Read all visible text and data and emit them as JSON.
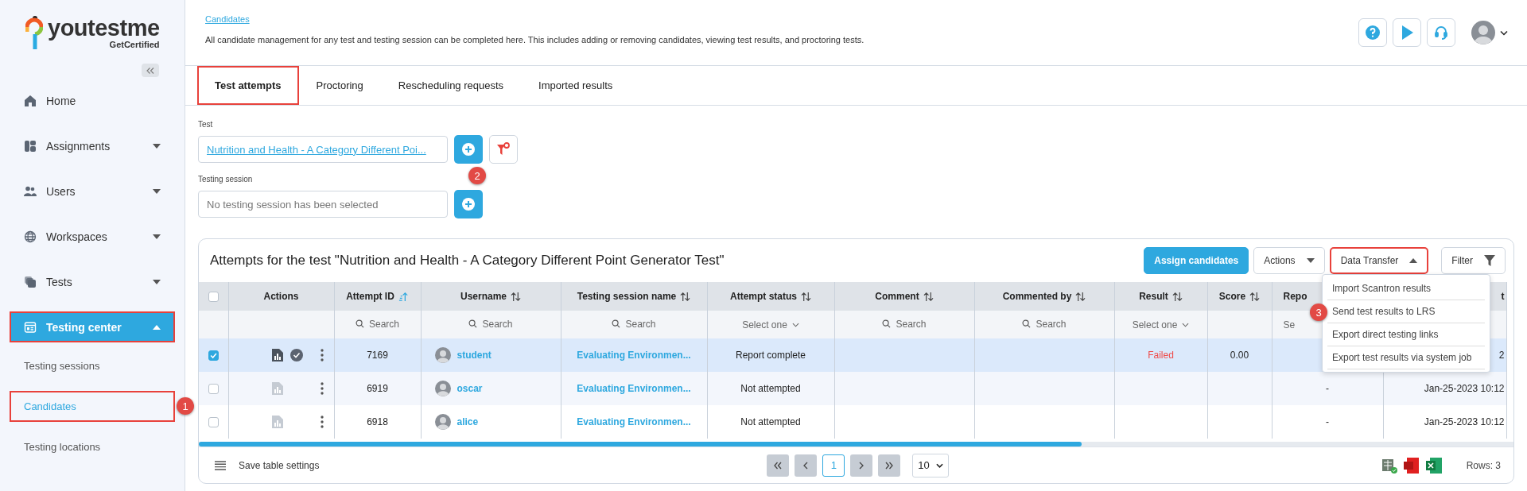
{
  "logo": {
    "name": "youtestme",
    "tagline": "GetCertified"
  },
  "sidebar": {
    "items": [
      {
        "kind": "home",
        "label": "Home",
        "selected": false,
        "highlighted": false
      },
      {
        "kind": "assignments",
        "label": "Assignments",
        "expanded": false,
        "selected": false,
        "highlighted": false
      },
      {
        "kind": "users",
        "label": "Users",
        "expanded": false,
        "selected": false,
        "highlighted": false
      },
      {
        "kind": "workspaces",
        "label": "Workspaces",
        "expanded": false,
        "selected": false,
        "highlighted": false
      },
      {
        "kind": "tests",
        "label": "Tests",
        "expanded": false,
        "selected": false,
        "highlighted": false
      },
      {
        "kind": "testing-center",
        "label": "Testing center",
        "expanded": true,
        "selected": true,
        "highlighted": true,
        "children": [
          {
            "label": "Testing sessions",
            "selected": false,
            "highlighted": false
          },
          {
            "label": "Candidates",
            "selected": true,
            "highlighted": true,
            "callout": "1"
          },
          {
            "label": "Testing locations",
            "selected": false,
            "highlighted": false
          }
        ]
      }
    ]
  },
  "header": {
    "breadcrumb": "Candidates",
    "description": "All candidate management for any test and testing session can be completed here. This includes adding or removing candidates, viewing test results, and proctoring tests."
  },
  "tabs": [
    {
      "label": "Test attempts",
      "selected": true,
      "highlighted": true
    },
    {
      "label": "Proctoring",
      "selected": false,
      "highlighted": false
    },
    {
      "label": "Rescheduling requests",
      "selected": false,
      "highlighted": false
    },
    {
      "label": "Imported results",
      "selected": false,
      "highlighted": false
    }
  ],
  "test_field": {
    "label": "Test",
    "value": "Nutrition and Health - A Category Different Poi...",
    "callout": "2"
  },
  "session_field": {
    "label": "Testing session",
    "placeholder": "No testing session has been selected"
  },
  "card": {
    "title": "Attempts for the test \"Nutrition and Health - A Category Different Point Generator Test\"",
    "buttons": [
      {
        "kind": "primary",
        "label": "Assign candidates",
        "highlighted": false
      },
      {
        "kind": "dropdown",
        "label": "Actions",
        "highlighted": false,
        "expanded": false
      },
      {
        "kind": "dropdown",
        "label": "Data Transfer",
        "highlighted": true,
        "expanded": true
      },
      {
        "kind": "filter",
        "label": "Filter",
        "highlighted": false
      }
    ],
    "menu": [
      {
        "label": "Import Scantron results"
      },
      {
        "label": "Send test results to LRS",
        "callout": "3"
      },
      {
        "label": "Export direct testing links"
      },
      {
        "label": "Export test results via system job"
      }
    ]
  },
  "table": {
    "columns": [
      {
        "kind": "check",
        "checked": false
      },
      {
        "kind": "text",
        "label": "Actions"
      },
      {
        "kind": "text",
        "label": "Attempt ID",
        "sortable": true,
        "sorted": true,
        "search_placeholder": "Search"
      },
      {
        "kind": "text",
        "label": "Username",
        "sortable": true,
        "sorted": false,
        "search_placeholder": "Search"
      },
      {
        "kind": "text",
        "label": "Testing session name",
        "sortable": true,
        "sorted": false,
        "search_placeholder": "Search"
      },
      {
        "kind": "text",
        "label": "Attempt status",
        "sortable": true,
        "sorted": false,
        "select_placeholder": "Select one"
      },
      {
        "kind": "text",
        "label": "Comment",
        "sortable": true,
        "sorted": false,
        "search_placeholder": "Search"
      },
      {
        "kind": "text",
        "label": "Commented by",
        "sortable": true,
        "sorted": false,
        "search_placeholder": "Search"
      },
      {
        "kind": "text",
        "label": "Result",
        "sortable": true,
        "sorted": false,
        "select_placeholder": "Select one"
      },
      {
        "kind": "text",
        "label": "Score",
        "sortable": true,
        "sorted": false
      },
      {
        "kind": "text",
        "label": "Repo",
        "filter_text": "Se"
      },
      {
        "kind": "text",
        "label": "t"
      }
    ],
    "rows": [
      {
        "selected": true,
        "report_available": true,
        "approved": true,
        "attempt_id": "7169",
        "username": "student",
        "session": "Evaluating Environmen...",
        "status": "Report complete",
        "result": "Failed",
        "failed": true,
        "score": "0.00",
        "last": "2"
      },
      {
        "selected": false,
        "report_available": false,
        "approved": false,
        "attempt_id": "6919",
        "username": "oscar",
        "session": "Evaluating Environmen...",
        "status": "Not attempted",
        "report": "-",
        "last": "Jan-25-2023 10:12"
      },
      {
        "selected": false,
        "report_available": false,
        "approved": false,
        "attempt_id": "6918",
        "username": "alice",
        "session": "Evaluating Environmen...",
        "status": "Not attempted",
        "report": "-",
        "last": "Jan-25-2023 10:12"
      }
    ]
  },
  "footer": {
    "save_settings": "Save table settings",
    "current_page": "1",
    "page_size": "10",
    "rows": "Rows: 3"
  }
}
